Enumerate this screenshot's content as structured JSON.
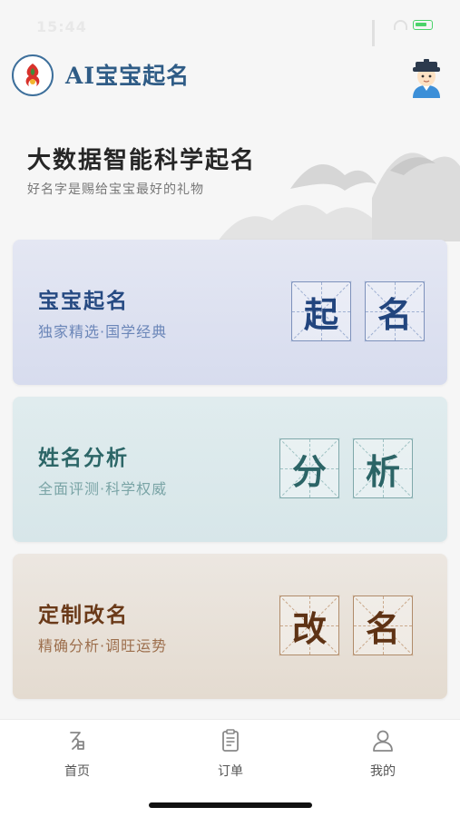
{
  "status_bar": {
    "time": "15:44"
  },
  "header": {
    "app_title": "AI宝宝起名"
  },
  "hero": {
    "title": "大数据智能科学起名",
    "subtitle": "好名字是赐给宝宝最好的礼物"
  },
  "cards": [
    {
      "title": "宝宝起名",
      "subtitle": "独家精选·国学经典",
      "chars": [
        "起",
        "名"
      ],
      "accent": "#264a82"
    },
    {
      "title": "姓名分析",
      "subtitle": "全面评测·科学权威",
      "chars": [
        "分",
        "析"
      ],
      "accent": "#2c6667"
    },
    {
      "title": "定制改名",
      "subtitle": "精确分析·调旺运势",
      "chars": [
        "改",
        "名"
      ],
      "accent": "#6a3a19"
    }
  ],
  "tabbar": {
    "home": {
      "label": "首页",
      "icon": "home-name-icon"
    },
    "orders": {
      "label": "订单",
      "icon": "clipboard-icon"
    },
    "mine": {
      "label": "我的",
      "icon": "user-icon"
    }
  }
}
